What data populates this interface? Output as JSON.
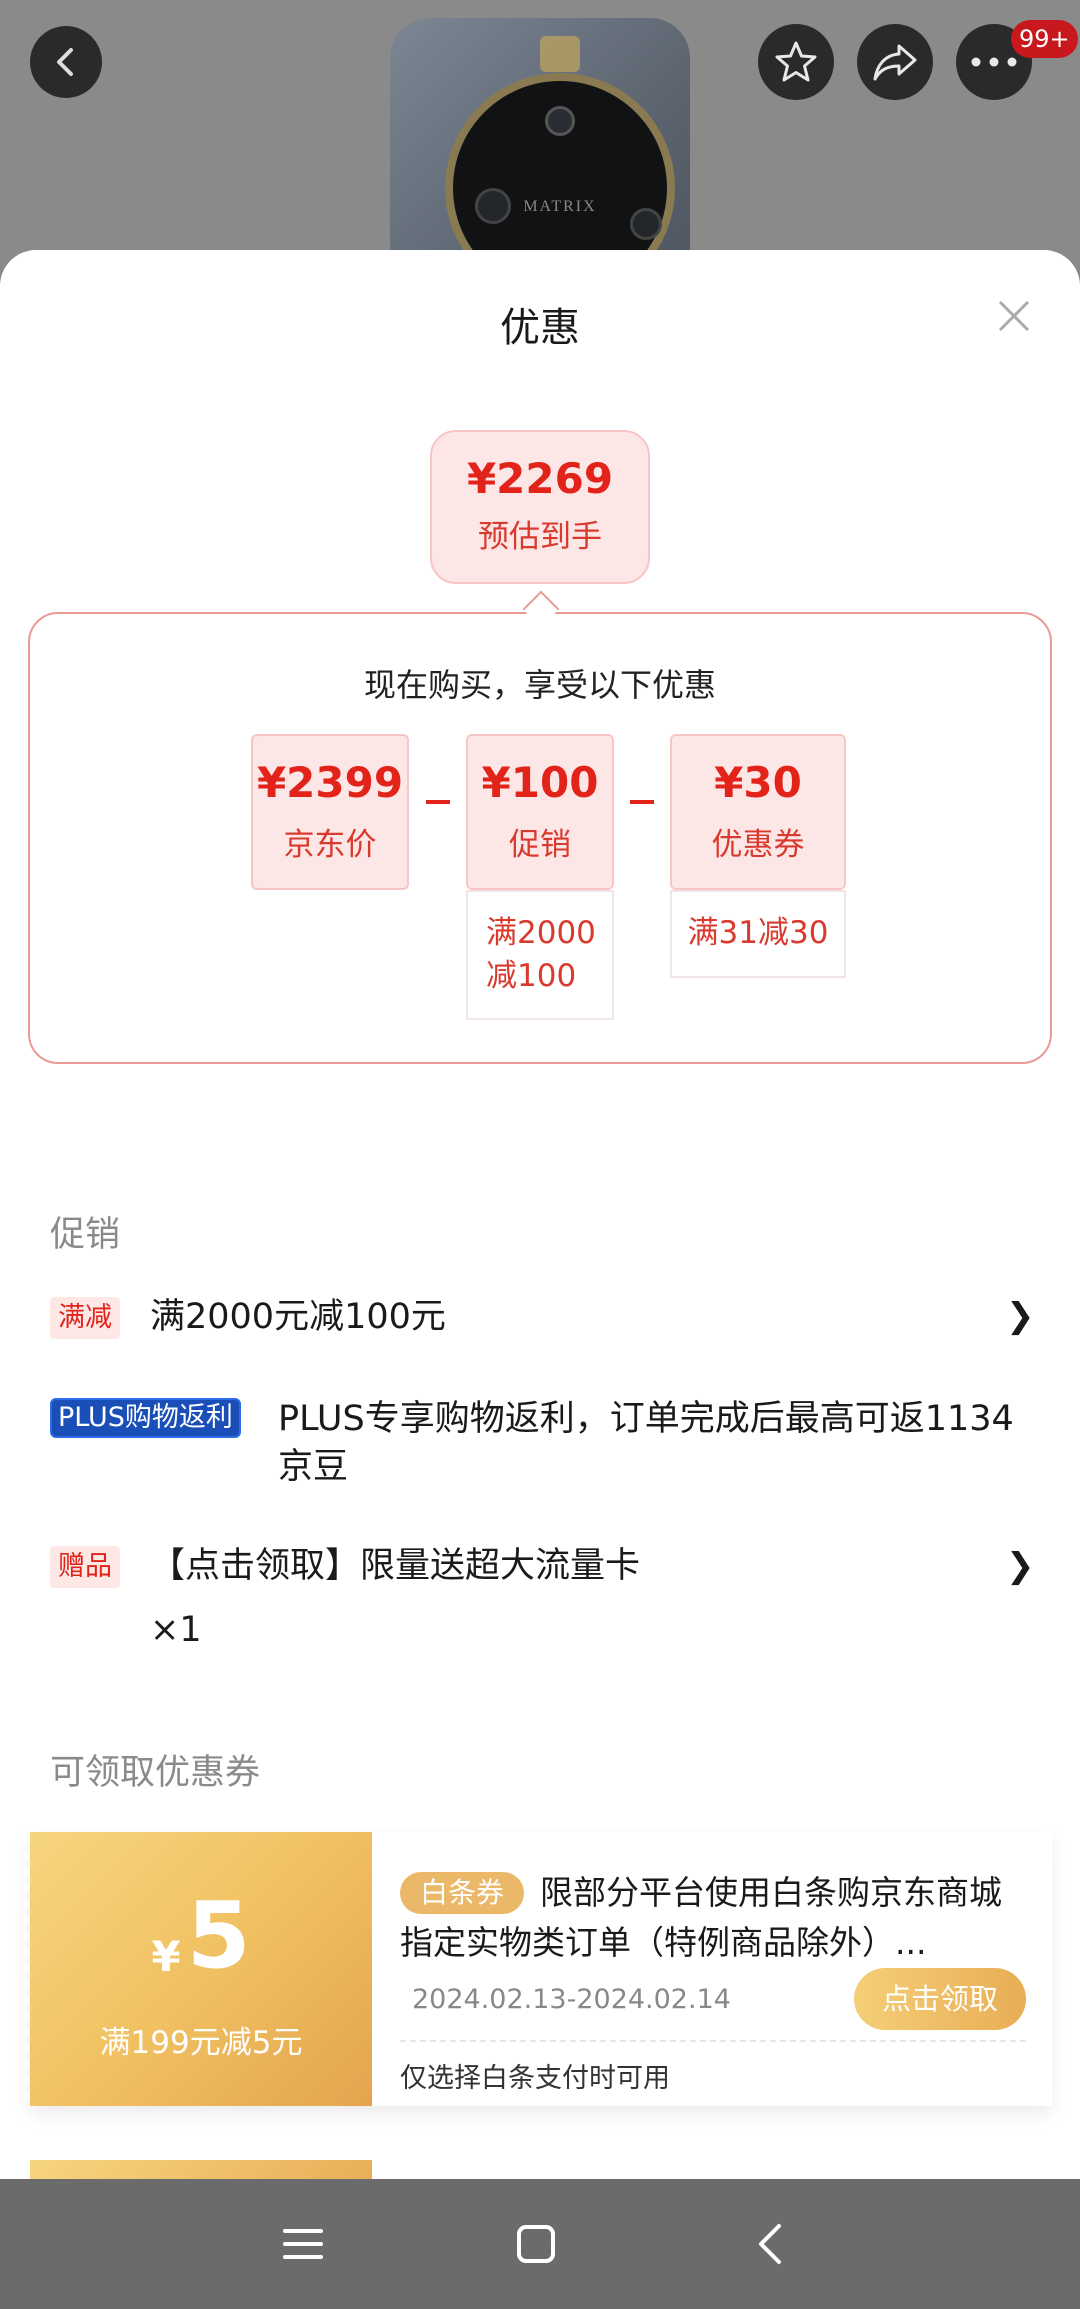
{
  "header": {
    "product_cam_text": "MATRIX",
    "more_badge": "99+"
  },
  "sheet": {
    "title": "优惠",
    "estimate": {
      "price": "¥2269",
      "label": "预估到手"
    },
    "breakdown_title": "现在购买，享受以下优惠",
    "items": [
      {
        "amount": "¥2399",
        "label": "京东价"
      },
      {
        "amount": "¥100",
        "label": "促销",
        "condition": "满2000减100"
      },
      {
        "amount": "¥30",
        "label": "优惠券",
        "condition": "满31减30"
      }
    ]
  },
  "promotions": {
    "section_label": "促销",
    "rows": [
      {
        "tag": "满减",
        "text": "满2000元减100元"
      },
      {
        "tag": "PLUS购物返利",
        "text": "PLUS专享购物返利，订单完成后最高可返1134京豆"
      },
      {
        "tag": "赠品",
        "text": "【点击领取】限量送超大流量卡",
        "sub": "×1"
      }
    ]
  },
  "coupons": {
    "section_label": "可领取优惠券",
    "items": [
      {
        "currency": "¥",
        "amount": "5",
        "condition": "满199元减5元",
        "tag": "白条券",
        "description": "限部分平台使用白条购京东商城指定实物类订单（特例商品除外）...",
        "date_range": "2024.02.13-2024.02.14",
        "button": "点击领取",
        "note": "仅选择白条支付时可用"
      }
    ]
  },
  "colors": {
    "accent": "#e2231a",
    "coupon_gold": "#eab868",
    "plus_blue": "#1a4fb8"
  }
}
